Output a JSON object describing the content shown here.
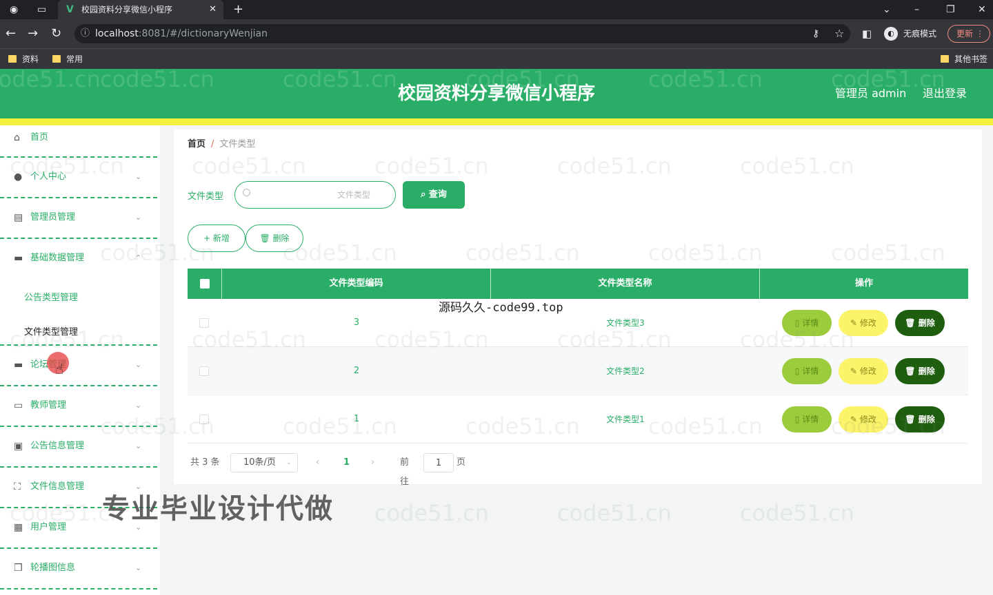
{
  "browser": {
    "tab_title": "校园资料分享微信小程序",
    "url_host": "localhost",
    "url_rest": ":8081/#/dictionaryWenjian",
    "incognito_label": "无痕模式",
    "update_label": "更新",
    "bookmarks": [
      "资料",
      "常用"
    ],
    "other_bookmarks": "其他书签"
  },
  "header": {
    "title": "校园资料分享微信小程序",
    "admin": "管理员 admin",
    "logout": "退出登录"
  },
  "sidebar": {
    "items": [
      {
        "label": "首页",
        "icon": "home-icon"
      },
      {
        "label": "个人中心",
        "icon": "user-icon"
      },
      {
        "label": "管理员管理",
        "icon": "document-icon"
      },
      {
        "label": "基础数据管理",
        "icon": "chat-icon"
      },
      {
        "label": "论坛管理",
        "icon": "chat-icon"
      },
      {
        "label": "教师管理",
        "icon": "card-icon"
      },
      {
        "label": "公告信息管理",
        "icon": "clipboard-icon"
      },
      {
        "label": "文件信息管理",
        "icon": "frame-icon"
      },
      {
        "label": "用户管理",
        "icon": "grid-icon"
      },
      {
        "label": "轮播图信息",
        "icon": "copy-icon"
      }
    ],
    "submenu": [
      "公告类型管理",
      "文件类型管理"
    ]
  },
  "breadcrumb": {
    "home": "首页",
    "sep": "/",
    "current": "文件类型"
  },
  "search": {
    "label": "文件类型",
    "placeholder": "文件类型",
    "button": "查询"
  },
  "actions": {
    "add": "+ 新增",
    "delete": "删除"
  },
  "table": {
    "headers": [
      "文件类型编码",
      "文件类型名称",
      "操作"
    ],
    "rows": [
      {
        "code": "3",
        "name": "文件类型3"
      },
      {
        "code": "2",
        "name": "文件类型2"
      },
      {
        "code": "1",
        "name": "文件类型1"
      }
    ],
    "ops": {
      "detail": "详情",
      "edit": "修改",
      "delete": "删除"
    }
  },
  "pagination": {
    "total": "共 3 条",
    "page_size": "10条/页",
    "current": "1",
    "goto": "前往",
    "goto_value": "1",
    "unit": "页"
  },
  "overlays": {
    "code99": "源码久久-code99.top",
    "ad": "专业毕业设计代做",
    "watermark": "code51.cn"
  },
  "colors": {
    "primary": "#2aae67",
    "strip": "#f2f23e",
    "detail": "#9ccc3c",
    "edit": "#fbf36a",
    "delete": "#1f5e0f"
  }
}
